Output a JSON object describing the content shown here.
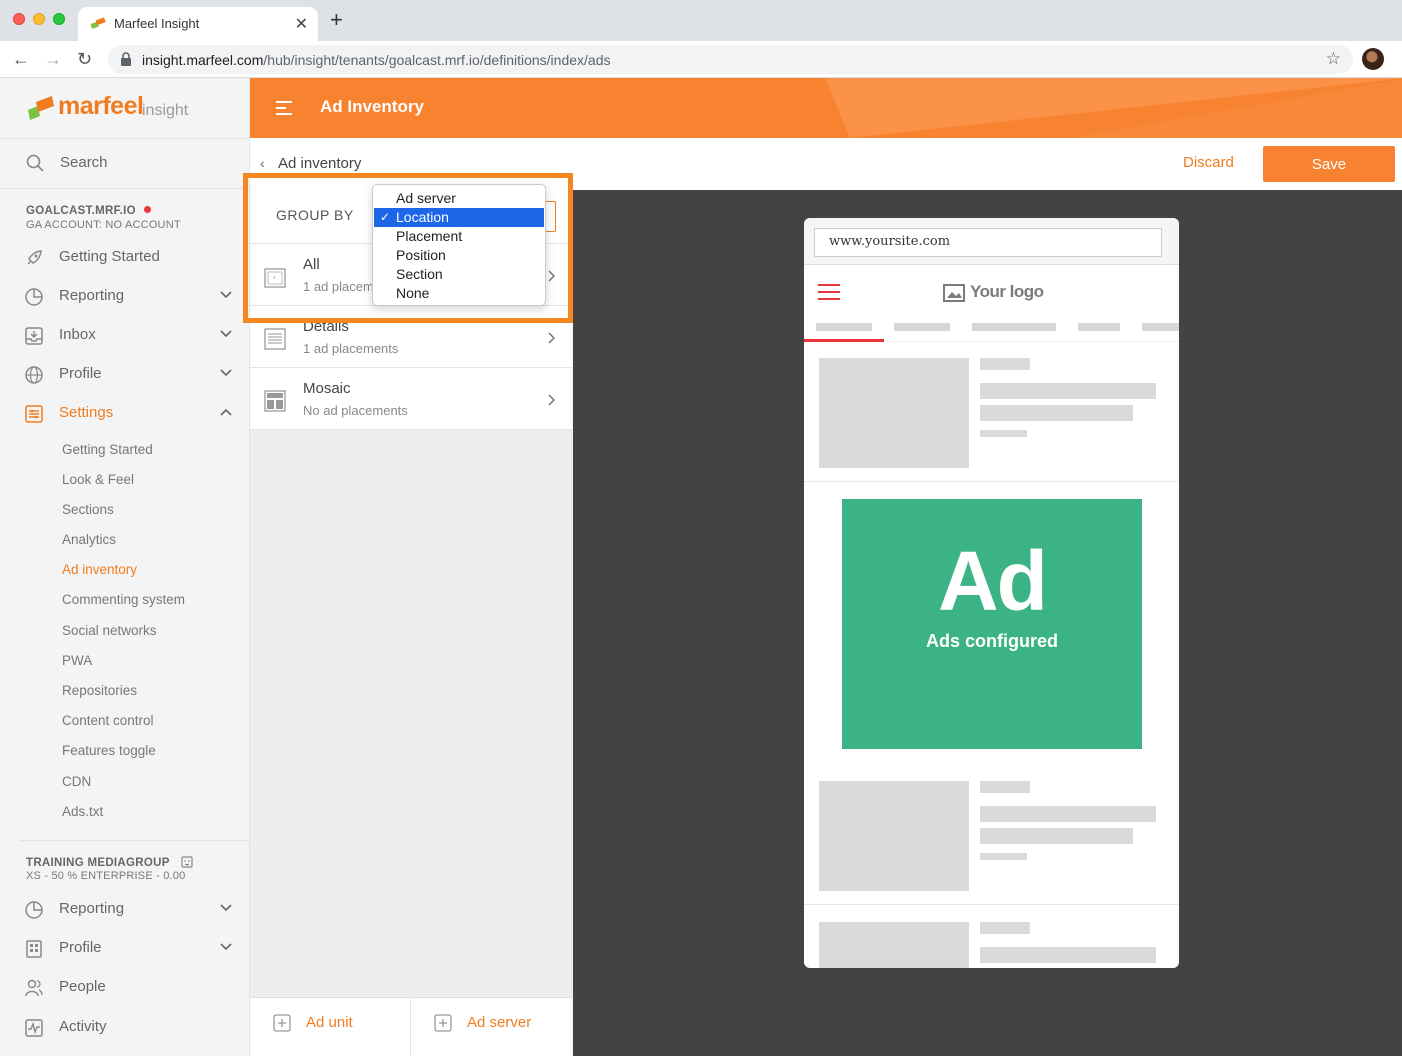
{
  "browser": {
    "tab_title": "Marfeel Insight",
    "url_domain": "insight.marfeel.com",
    "url_path": "/hub/insight/tenants/goalcast.mrf.io/definitions/index/ads"
  },
  "sidebar": {
    "logo_text": "marfeel",
    "logo_sub": "insight",
    "search_label": "Search",
    "account_name": "GOALCAST.MRF.IO",
    "account_sub": "GA ACCOUNT: NO ACCOUNT",
    "nav": [
      {
        "label": "Getting Started",
        "icon": "rocket-icon"
      },
      {
        "label": "Reporting",
        "icon": "pie-chart-icon"
      },
      {
        "label": "Inbox",
        "icon": "inbox-icon"
      },
      {
        "label": "Profile",
        "icon": "globe-icon"
      },
      {
        "label": "Settings",
        "icon": "settings-icon"
      }
    ],
    "settings_sub": [
      "Getting Started",
      "Look & Feel",
      "Sections",
      "Analytics",
      "Ad inventory",
      "Commenting system",
      "Social networks",
      "PWA",
      "Repositories",
      "Content control",
      "Features toggle",
      "CDN",
      "Ads.txt"
    ],
    "org_name": "TRAINING MEDIAGROUP",
    "org_sub": "XS - 50 % ENTERPRISE - 0.00",
    "org_nav": [
      {
        "label": "Reporting",
        "icon": "pie-chart-icon"
      },
      {
        "label": "Profile",
        "icon": "building-icon"
      },
      {
        "label": "People",
        "icon": "people-icon"
      },
      {
        "label": "Activity",
        "icon": "activity-icon"
      }
    ]
  },
  "header": {
    "title": "Ad Inventory"
  },
  "subheader": {
    "breadcrumb": "Ad inventory",
    "discard": "Discard",
    "save": "Save"
  },
  "list": {
    "group_by_label": "GROUP BY",
    "rows": [
      {
        "title": "All",
        "sub": "1 ad placem",
        "icon": "page-icon"
      },
      {
        "title": "Details",
        "sub": "1 ad placements",
        "icon": "lines-icon"
      },
      {
        "title": "Mosaic",
        "sub": "No ad placements",
        "icon": "mosaic-icon"
      }
    ],
    "add_unit": "Ad unit",
    "add_server": "Ad server"
  },
  "dropdown": {
    "options": [
      "Ad server",
      "Location",
      "Placement",
      "Position",
      "Section",
      "None"
    ],
    "selected": "Location"
  },
  "preview": {
    "url": "www.yoursite.com",
    "logo_text": "Your logo",
    "ad_text": "Ad",
    "ad_sub": "Ads configured",
    "ad_color": "#3bb384"
  },
  "colors": {
    "brand_orange": "#f7822f",
    "accent_red": "#e8353b",
    "select_blue": "#1d66e8"
  }
}
